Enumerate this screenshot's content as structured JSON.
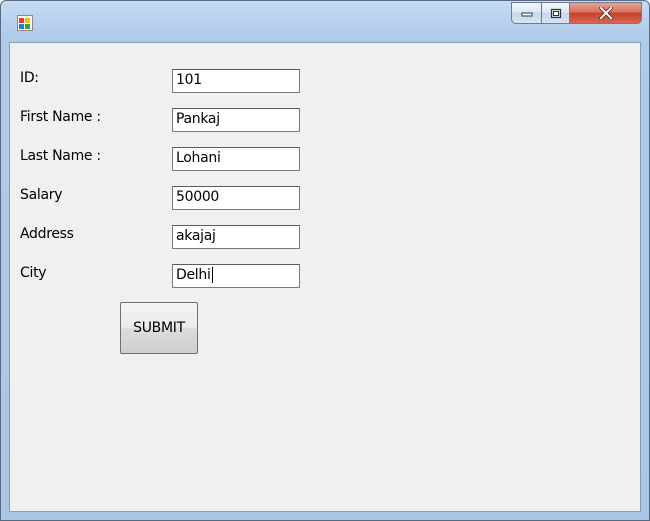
{
  "window": {
    "icon": "windows-form-app-icon",
    "controls": {
      "minimize": "minimize-icon",
      "maximize": "maximize-icon",
      "close": "close-icon"
    }
  },
  "form": {
    "fields": [
      {
        "label": "ID:",
        "value": "101"
      },
      {
        "label": "First Name :",
        "value": "Pankaj"
      },
      {
        "label": "Last Name :",
        "value": "Lohani"
      },
      {
        "label": "Salary",
        "value": "50000"
      },
      {
        "label": "Address",
        "value": "akajaj"
      },
      {
        "label": "City",
        "value": "Delhi"
      }
    ],
    "submit_label": "SUBMIT"
  }
}
